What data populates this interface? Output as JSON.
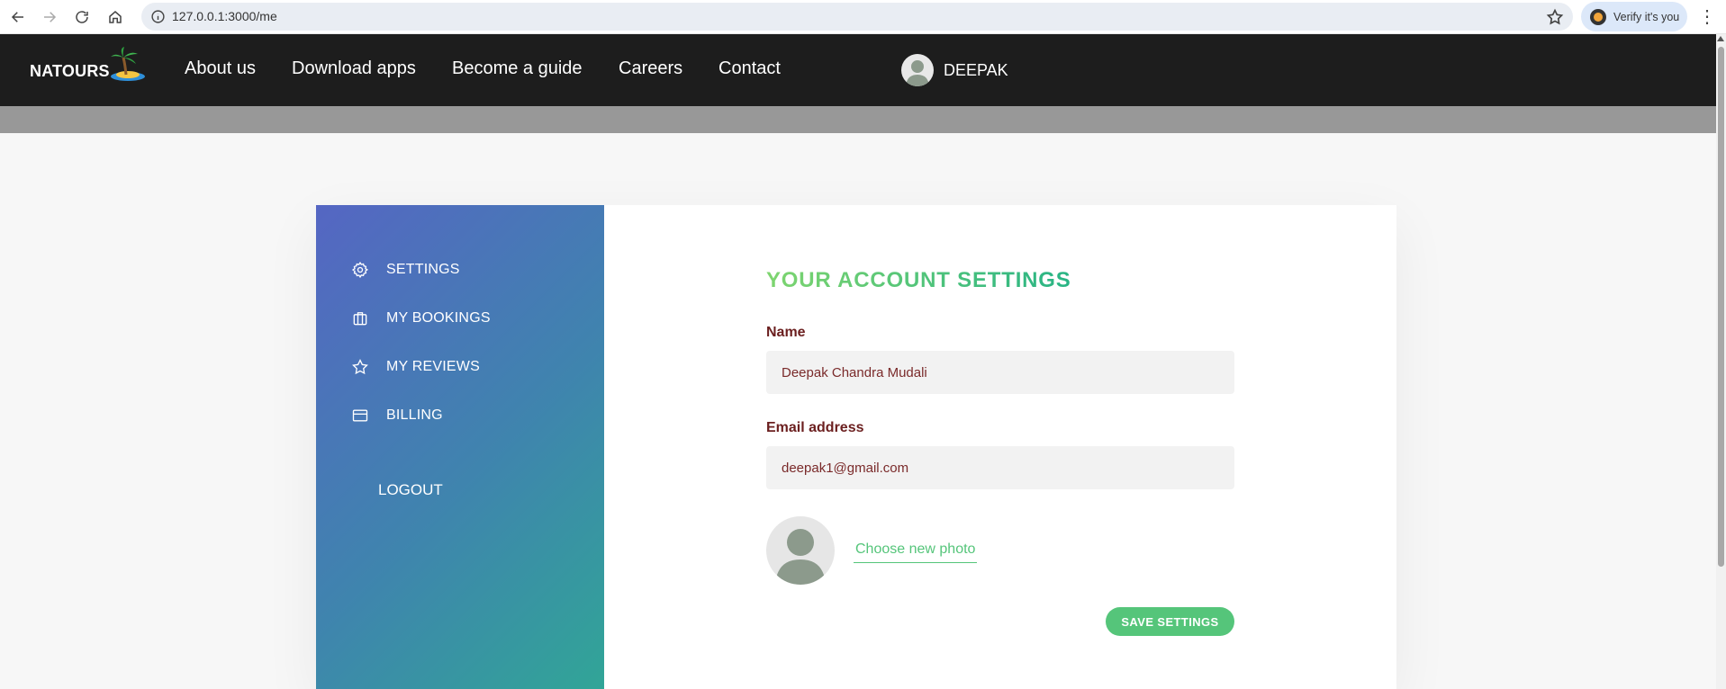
{
  "browser": {
    "url": "127.0.0.1:3000/me",
    "verify_label": "Verify it's you"
  },
  "header": {
    "logo_text": "NATOURS",
    "nav": [
      "About us",
      "Download apps",
      "Become a guide",
      "Careers",
      "Contact"
    ],
    "user_name": "DEEPAK"
  },
  "sidebar": {
    "items": [
      {
        "label": "SETTINGS",
        "icon": "gear-icon"
      },
      {
        "label": "MY BOOKINGS",
        "icon": "briefcase-icon"
      },
      {
        "label": "MY REVIEWS",
        "icon": "star-icon"
      },
      {
        "label": "BILLING",
        "icon": "credit-card-icon"
      }
    ],
    "logout_label": "LOGOUT"
  },
  "settings": {
    "title": "YOUR ACCOUNT SETTINGS",
    "name_label": "Name",
    "name_value": "Deepak Chandra Mudali",
    "email_label": "Email address",
    "email_value": "deepak1@gmail.com",
    "choose_photo_label": "Choose new photo",
    "save_label": "SAVE SETTINGS"
  },
  "colors": {
    "accent_green": "#55c57a",
    "header_bg": "#1d1d1d",
    "label_color": "#6b1f1f"
  }
}
